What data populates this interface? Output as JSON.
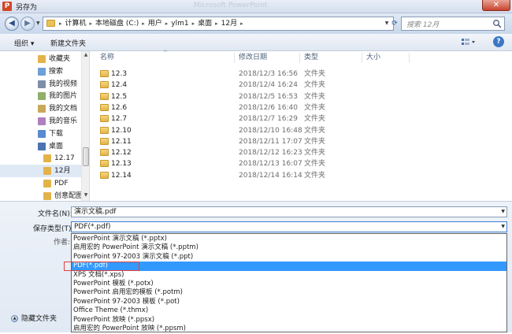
{
  "window": {
    "title": "另存为",
    "faded_title": "Microsoft PowerPoint",
    "close_label": "✕"
  },
  "address": {
    "crumbs": [
      "计算机",
      "本地磁盘 (C:)",
      "用户",
      "ylm1",
      "桌面",
      "12月"
    ],
    "search_placeholder": "搜索 12月"
  },
  "toolbar": {
    "organize": "组织 ▾",
    "new_folder": "新建文件夹"
  },
  "nav": {
    "items": [
      {
        "label": "收藏夹",
        "icon": "folder-icon",
        "indent": 0
      },
      {
        "label": "搜索",
        "icon": "search-folder-icon",
        "indent": 0
      },
      {
        "label": "我的视频",
        "icon": "videos-icon",
        "indent": 0
      },
      {
        "label": "我的图片",
        "icon": "pictures-icon",
        "indent": 0
      },
      {
        "label": "我的文档",
        "icon": "documents-icon",
        "indent": 0
      },
      {
        "label": "我的音乐",
        "icon": "music-icon",
        "indent": 0
      },
      {
        "label": "下载",
        "icon": "download-icon",
        "indent": 0
      },
      {
        "label": "桌面",
        "icon": "desktop-icon",
        "indent": 0
      },
      {
        "label": "12.17",
        "icon": "folder-icon",
        "indent": 1
      },
      {
        "label": "12月",
        "icon": "folder-icon",
        "indent": 1,
        "selected": true
      },
      {
        "label": "PDF",
        "icon": "folder-icon",
        "indent": 1
      },
      {
        "label": "创意配图",
        "icon": "folder-icon",
        "indent": 1
      }
    ]
  },
  "columns": {
    "name": "名称",
    "date": "修改日期",
    "type": "类型",
    "size": "大小"
  },
  "files": [
    {
      "name": "12.3",
      "date": "2018/12/3 16:56",
      "type": "文件夹"
    },
    {
      "name": "12.4",
      "date": "2018/12/4 16:24",
      "type": "文件夹"
    },
    {
      "name": "12.5",
      "date": "2018/12/5 16:53",
      "type": "文件夹"
    },
    {
      "name": "12.6",
      "date": "2018/12/6 16:40",
      "type": "文件夹"
    },
    {
      "name": "12.7",
      "date": "2018/12/7 16:29",
      "type": "文件夹"
    },
    {
      "name": "12.10",
      "date": "2018/12/10 16:48",
      "type": "文件夹"
    },
    {
      "name": "12.11",
      "date": "2018/12/11 17:07",
      "type": "文件夹"
    },
    {
      "name": "12.12",
      "date": "2018/12/12 16:23",
      "type": "文件夹"
    },
    {
      "name": "12.13",
      "date": "2018/12/13 16:07",
      "type": "文件夹"
    },
    {
      "name": "12.14",
      "date": "2018/12/14 16:14",
      "type": "文件夹"
    }
  ],
  "form": {
    "filename_label": "文件名(N):",
    "filename_value": "演示文稿.pdf",
    "filetype_label": "保存类型(T):",
    "filetype_value": "PDF(*.pdf)",
    "author_label": "作者:"
  },
  "filetype_options": [
    "PowerPoint 演示文稿 (*.pptx)",
    "启用宏的 PowerPoint 演示文稿 (*.pptm)",
    "PowerPoint 97-2003 演示文稿 (*.ppt)",
    "PDF(*.pdf)",
    "XPS 文档(*.xps)",
    "PowerPoint 模板 (*.potx)",
    "PowerPoint 启用宏的模板 (*.potm)",
    "PowerPoint 97-2003 模板 (*.pot)",
    "Office Theme (*.thmx)",
    "PowerPoint 放映 (*.ppsx)",
    "启用宏的 PowerPoint 放映 (*.ppsm)"
  ],
  "selected_option_index": 3,
  "hide_folders": "隐藏文件夹",
  "colors": {
    "selection": "#3399ff",
    "highlight_outline": "#e04040"
  }
}
